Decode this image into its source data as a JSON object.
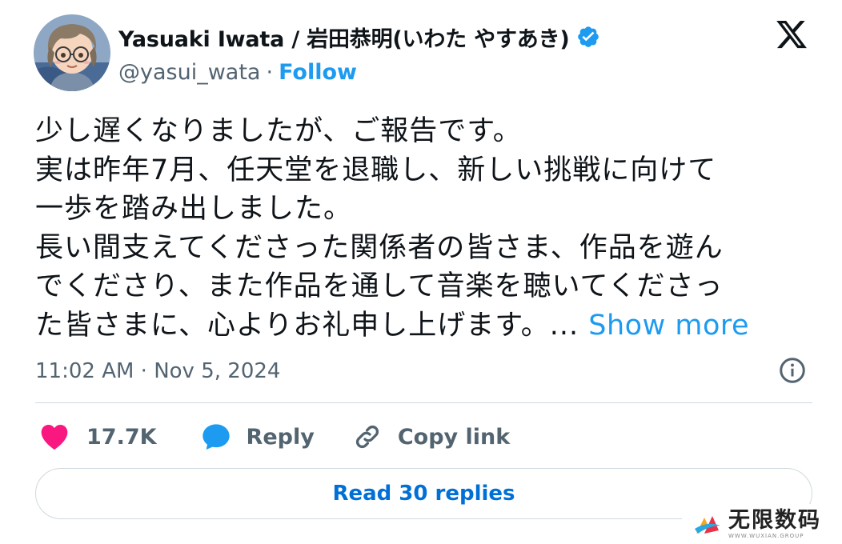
{
  "author": {
    "display_name": "Yasuaki Iwata / 岩田恭明(いわた やすあき)",
    "handle": "@yasui_wata",
    "separator": "·",
    "follow_label": "Follow",
    "verified_icon": "verified-badge-icon"
  },
  "brand": {
    "logo_icon": "x-logo-icon"
  },
  "tweet": {
    "lines": [
      "少し遅くなりましたが、ご報告です。",
      "実は昨年7月、任天堂を退職し、新しい挑戦に向けて",
      "一歩を踏み出しました。",
      "長い間支えてくださった関係者の皆さま、作品を遊ん",
      "でくださり、また作品を通して音楽を聴いてくださっ",
      "た皆さまに、心よりお礼申し上げます。..."
    ],
    "show_more_label": "Show more",
    "timestamp": "11:02 AM · Nov 5, 2024"
  },
  "actions": {
    "like_count": "17.7K",
    "reply_label": "Reply",
    "copy_link_label": "Copy link"
  },
  "read_replies_label": "Read 30 replies",
  "watermark": {
    "title": "无限数码",
    "subtitle": "WWW.WUXIAN.GROUP"
  },
  "colors": {
    "accent": "#1d9bf0",
    "text_primary": "#0f1419",
    "text_secondary": "#536471",
    "like": "#f91880",
    "divider": "#cfd9de",
    "read_replies": "#006fd6"
  }
}
